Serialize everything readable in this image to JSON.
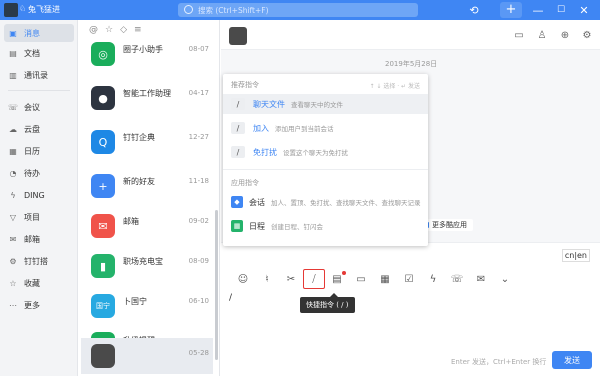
{
  "titlebar": {
    "app_name": "兔飞猛进",
    "search_placeholder": "搜索 (Ctrl+Shift+F)",
    "history_icon": "clock-icon",
    "add_label": "+",
    "minimize": "—",
    "maximize": "☐",
    "close": "✕"
  },
  "nav": {
    "items": [
      {
        "label": "消息",
        "icon": "chat-icon"
      },
      {
        "label": "文档",
        "icon": "doc-icon"
      },
      {
        "label": "通讯录",
        "icon": "contacts-icon"
      },
      {
        "label": "会议",
        "icon": "phone-icon"
      },
      {
        "label": "云盘",
        "icon": "cloud-icon"
      },
      {
        "label": "日历",
        "icon": "calendar-icon"
      },
      {
        "label": "待办",
        "icon": "todo-icon"
      },
      {
        "label": "DING",
        "icon": "ding-icon"
      },
      {
        "label": "项目",
        "icon": "project-icon"
      },
      {
        "label": "邮箱",
        "icon": "mail-icon"
      },
      {
        "label": "钉钉搭",
        "icon": "build-icon"
      },
      {
        "label": "收藏",
        "icon": "star-icon"
      },
      {
        "label": "更多",
        "icon": "more-icon"
      }
    ]
  },
  "conversations": [
    {
      "name": "圈子小助手",
      "date": "08-07",
      "color": "#1aad5b",
      "glyph": "◎"
    },
    {
      "name": "智能工作助理",
      "date": "04-17",
      "color": "#2d3440",
      "glyph": "●"
    },
    {
      "name": "钉钉企典",
      "date": "12-27",
      "color": "#1e88e5",
      "glyph": "Q"
    },
    {
      "name": "新的好友",
      "date": "11-18",
      "color": "#3f86f3",
      "glyph": "+"
    },
    {
      "name": "邮箱",
      "date": "09-02",
      "color": "#f0534a",
      "glyph": "✉"
    },
    {
      "name": "职场充电宝",
      "date": "08-09",
      "color": "#24b36b",
      "glyph": "▮"
    },
    {
      "name": "卜国宁",
      "date": "06-10",
      "color": "#27a9e1",
      "glyph": "国宁"
    },
    {
      "name": "升级提醒",
      "date": "",
      "color": "#1aad5b",
      "glyph": "↑"
    },
    {
      "name": "",
      "date": "05-28",
      "color": "#4a4a4a",
      "glyph": ""
    }
  ],
  "chat": {
    "title": "",
    "date_divider": "2019年5月28日",
    "more_apps": "更多酷应用",
    "cnen": "cn|en",
    "hint": "Enter 发送，Ctrl+Enter 换行",
    "send": "发送",
    "tooltip": "快捷指令 ( / )",
    "caret": "/"
  },
  "popup": {
    "recommend_title": "推荐指令",
    "nav_hint": "↑ ↓ 选择 · ↵ 发送",
    "commands": [
      {
        "name": "聊天文件",
        "desc": "查看聊天中的文件"
      },
      {
        "name": "加入",
        "desc": "添加用户到当前会话"
      },
      {
        "name": "免打扰",
        "desc": "设置这个聊天为免打扰"
      }
    ],
    "app_title": "应用指令",
    "apps": [
      {
        "name": "会话",
        "desc": "加人、置顶、免打扰、查找聊天文件、查找聊天记录",
        "color": "#3f86f3",
        "glyph": "◆"
      },
      {
        "name": "日程",
        "desc": "创建日程、钉闪会",
        "color": "#24b36b",
        "glyph": "▦"
      }
    ]
  },
  "toolbar_icons": [
    "emoji-icon",
    "thumb-icon",
    "scissors-icon",
    "slash-command-icon",
    "new-doc-icon",
    "folder-icon",
    "calendar-icon",
    "check-icon",
    "ding-icon",
    "phone-icon",
    "mail-icon",
    "chevron-down-icon"
  ]
}
